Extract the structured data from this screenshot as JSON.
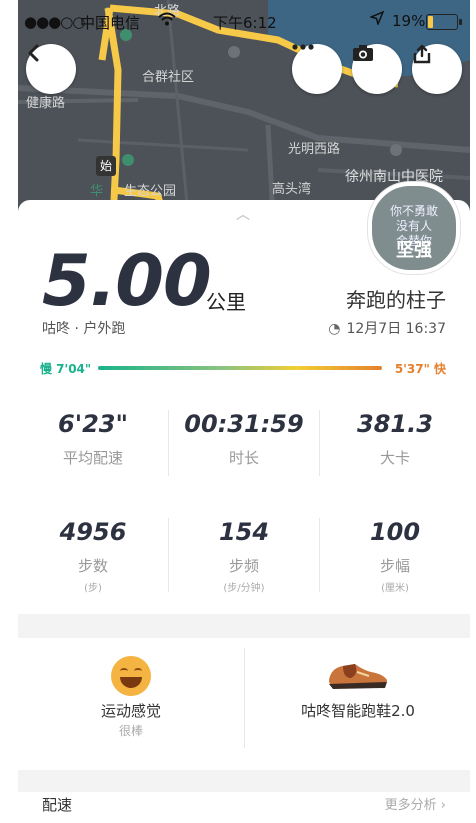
{
  "status_bar": {
    "signal": "●●●○○",
    "carrier": "中国电信",
    "time": "下午6:12",
    "battery": "19%",
    "battery_level": 0.19
  },
  "map": {
    "labels": [
      "合群社区",
      "健康路",
      "光明西路",
      "徐州南山中医院",
      "高头湾",
      "华",
      "生态公园",
      "北路"
    ],
    "start_marker": "始"
  },
  "header_buttons": {
    "back_icon": "chevron-left-icon",
    "more_icon": "more-dots-icon",
    "camera_icon": "camera-icon",
    "share_icon": "share-icon"
  },
  "badge": {
    "line1": "你不勇敢",
    "line2": "没有人",
    "line3": "会替你",
    "line4": "坚强"
  },
  "summary": {
    "distance": "5.00",
    "unit": "公里",
    "user_name": "奔跑的柱子",
    "activity": "咕咚 · 户外跑",
    "datetime": "12月7日 16:37"
  },
  "pace_bar": {
    "slow_label": "慢 7'04\"",
    "fast_label": "5'37\" 快"
  },
  "stats_row1": [
    {
      "value": "6'23\"",
      "label": "平均配速"
    },
    {
      "value": "00:31:59",
      "label": "时长"
    },
    {
      "value": "381.3",
      "label": "大卡"
    }
  ],
  "stats_row2": [
    {
      "value": "4956",
      "label": "步数",
      "sub": "(步)"
    },
    {
      "value": "154",
      "label": "步频",
      "sub": "(步/分钟)"
    },
    {
      "value": "100",
      "label": "步幅",
      "sub": "(厘米)"
    }
  ],
  "feel": {
    "title": "运动感觉",
    "sub": "很棒"
  },
  "shoe": {
    "title": "咕咚智能跑鞋2.0"
  },
  "bottom": {
    "pace_label": "配速",
    "more_label": "更多分析 ›"
  },
  "colors": {
    "slow": "#19b28b",
    "fast": "#e5802e",
    "track": "#f7c948",
    "value_text": "#2d3240"
  }
}
